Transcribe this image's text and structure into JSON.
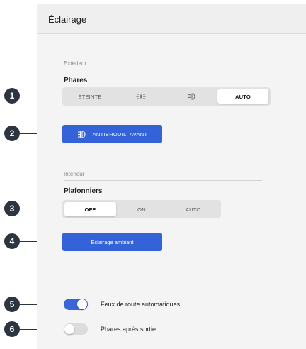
{
  "header": {
    "title": "Éclairage"
  },
  "exterior": {
    "section_label": "Extérieur",
    "phares": {
      "title": "Phares",
      "options": [
        {
          "label": "ÉTEINTE",
          "icon": null
        },
        {
          "label": "",
          "icon": "parking-lights-icon"
        },
        {
          "label": "",
          "icon": "low-beam-icon"
        },
        {
          "label": "AUTO",
          "icon": null
        }
      ],
      "selected": "AUTO"
    },
    "fog_button": {
      "label": "ANTIBROUIL. AVANT",
      "icon": "front-fog-light-icon"
    }
  },
  "interior": {
    "section_label": "Intérieur",
    "plafonniers": {
      "title": "Plafonniers",
      "options": [
        "OFF",
        "ON",
        "AUTO"
      ],
      "selected": "OFF"
    },
    "ambient_button": {
      "label": "Éclairage ambiant"
    }
  },
  "toggles": [
    {
      "label": "Feux de route automatiques",
      "on": true
    },
    {
      "label": "Phares après sortie",
      "on": false
    }
  ],
  "callouts": [
    "1",
    "2",
    "3",
    "4",
    "5",
    "6"
  ],
  "colors": {
    "accent": "#3462d8",
    "callout": "#2d3640",
    "panel": "#f4f4f4"
  }
}
